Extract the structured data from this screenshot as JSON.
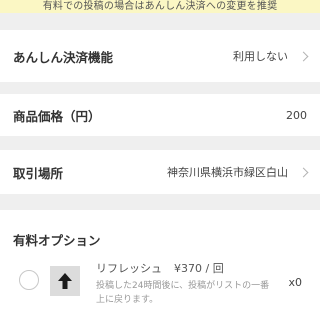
{
  "notice": {
    "text": "有料での投稿の場合はあんしん決済への変更を推奨"
  },
  "payment": {
    "label": "あんしん決済機能",
    "value": "利用しない"
  },
  "price": {
    "label": "商品価格（円）",
    "value": "200"
  },
  "place": {
    "label": "取引場所",
    "value": "神奈川県横浜市緑区白山"
  },
  "paid_options": {
    "title": "有料オプション",
    "items": [
      {
        "name": "リフレッシュ",
        "price": "¥370 / 回",
        "description": "投稿した24時間後に、投稿がリストの一番上に戻ります。",
        "count": "x0",
        "icon": "arrow-up-icon"
      }
    ]
  }
}
